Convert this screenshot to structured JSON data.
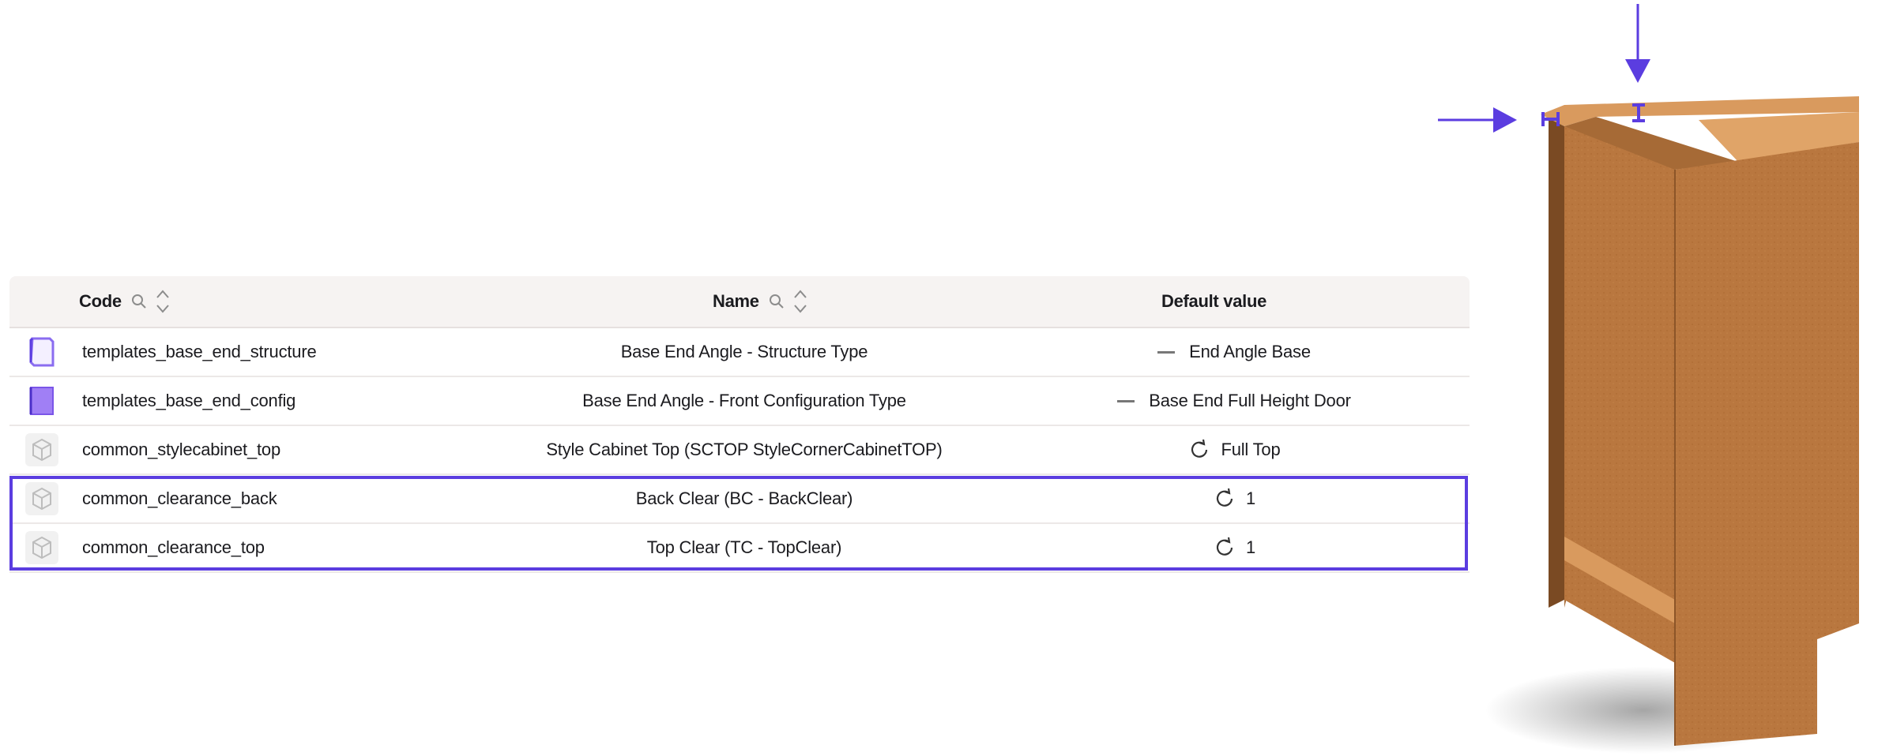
{
  "table": {
    "headers": {
      "code": "Code",
      "name": "Name",
      "default_value": "Default value"
    },
    "rows": [
      {
        "thumb": "purple-outline-panel-thumbnail",
        "code": "templates_base_end_structure",
        "name": "Base End Angle - Structure Type",
        "default_icon": "dash-icon",
        "default_value": "End Angle Base"
      },
      {
        "thumb": "purple-filled-panel-thumbnail",
        "code": "templates_base_end_config",
        "name": "Base End Angle - Front Configuration Type",
        "default_icon": "dash-icon",
        "default_value": "Base End Full Height Door"
      },
      {
        "thumb": "cube-icon",
        "code": "common_stylecabinet_top",
        "name": "Style Cabinet Top (SCTOP StyleCornerCabinetTOP)",
        "default_icon": "refresh-icon",
        "default_value": "Full Top"
      },
      {
        "thumb": "cube-icon",
        "code": "common_clearance_back",
        "name": "Back Clear (BC - BackClear)",
        "default_icon": "refresh-icon",
        "default_value": "1"
      },
      {
        "thumb": "cube-icon",
        "code": "common_clearance_top",
        "name": "Top Clear (TC - TopClear)",
        "default_icon": "refresh-icon",
        "default_value": "1"
      }
    ]
  },
  "colors": {
    "accent": "#5b3de0",
    "header_bg": "#f6f3f2",
    "wood": "#b9773f"
  },
  "illustration": {
    "description_icons": [
      "arrow-down-icon",
      "arrow-right-icon",
      "cabinet-illustration"
    ]
  }
}
